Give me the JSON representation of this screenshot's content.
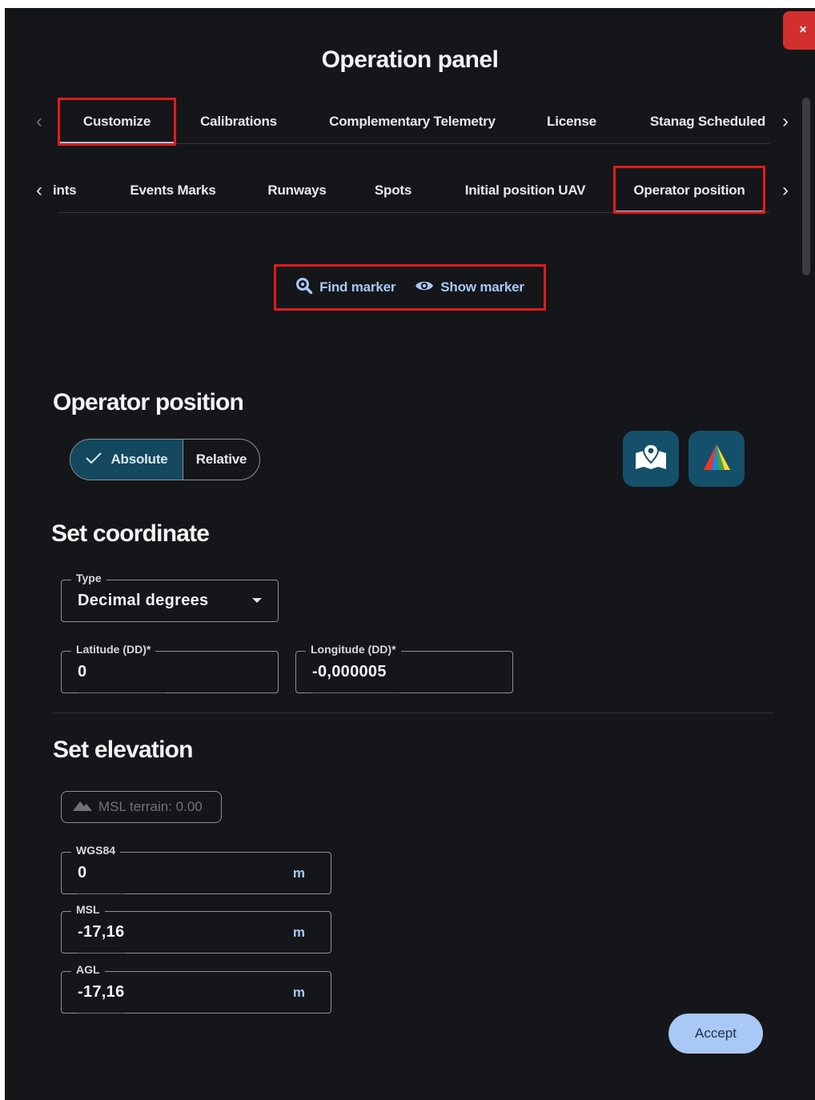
{
  "panel": {
    "title": "Operation panel",
    "close_label": "×"
  },
  "tabs_primary": {
    "items": [
      "Customize",
      "Calibrations",
      "Complementary Telemetry",
      "License",
      "Stanag Scheduled"
    ],
    "active": "Customize"
  },
  "tabs_secondary": {
    "items": [
      "ints",
      "Events Marks",
      "Runways",
      "Spots",
      "Initial position UAV",
      "Operator position"
    ],
    "active": "Operator position"
  },
  "markers": {
    "find_label": "Find marker",
    "show_label": "Show marker"
  },
  "operator_position": {
    "heading": "Operator position",
    "mode_options": [
      "Absolute",
      "Relative"
    ],
    "mode_selected": "Absolute"
  },
  "coordinate": {
    "heading": "Set coordinate",
    "type_label": "Type",
    "type_value": "Decimal degrees",
    "latitude_label": "Latitude (DD)*",
    "latitude_value": "0",
    "longitude_label": "Longitude (DD)*",
    "longitude_value": "-0,000005"
  },
  "elevation": {
    "heading": "Set elevation",
    "terrain_chip": "MSL terrain: 0.00",
    "fields": [
      {
        "label": "WGS84",
        "value": "0",
        "unit": "m"
      },
      {
        "label": "MSL",
        "value": "-17,16",
        "unit": "m"
      },
      {
        "label": "AGL",
        "value": "-17,16",
        "unit": "m"
      }
    ]
  },
  "actions": {
    "accept_label": "Accept"
  },
  "colors": {
    "background": "#14161a",
    "accent": "#a9c8f5",
    "segment_active": "#13485f",
    "highlight": "#e11b1b",
    "close": "#d32f2f"
  }
}
